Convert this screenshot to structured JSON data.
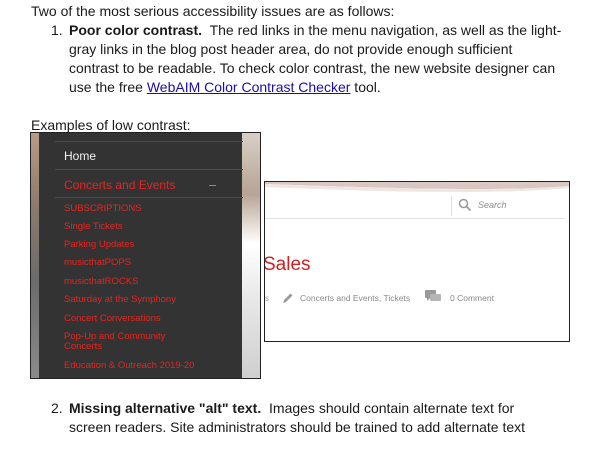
{
  "intro": "Two of the most serious accessibility issues are as follows:",
  "issues": [
    {
      "number": "1.",
      "title": "Poor color contrast.",
      "text_line1": "The red links in the menu navigation, as well as the light-",
      "text_line2": "gray links in the blog post header area, do not provide enough sufficient",
      "text_line3": "contrast to be readable.  To check color contrast, the new website designer can",
      "text_line4_before": "use the free ",
      "link_text": "WebAIM Color Contrast Checker",
      "text_line4_after": " tool."
    },
    {
      "number": "2.",
      "title": "Missing alternative \"alt\" text.",
      "text_line1": "Images should contain alternate text for",
      "text_line2": "screen readers.  Site administrators should be trained to add alternate text"
    }
  ],
  "examples_label": "Examples of low contrast:",
  "menu_example": {
    "home": "Home",
    "parent": "Concerts and Events",
    "parent_toggle": "–",
    "subitems": [
      "SUBSCRIPTIONS",
      "Single Tickets",
      "Parking Updates",
      "musicthatPOPS",
      "musicthatROCKS",
      "Saturday at the Symphony",
      "Concert Conversations",
      "Pop-Up and Community Concerts",
      "Education & Outreach 2019-20"
    ]
  },
  "blog_example": {
    "search_placeholder": "Search",
    "title_fragment": "Sales",
    "meta_leading": "s",
    "categories": "Concerts and Events, Tickets",
    "comments": "0 Comment"
  },
  "colors": {
    "menu_bg": "#333333",
    "menu_link_red": "#e8241f",
    "blog_meta_gray": "#8a8a8a",
    "hyperlink": "#1a0dab"
  }
}
